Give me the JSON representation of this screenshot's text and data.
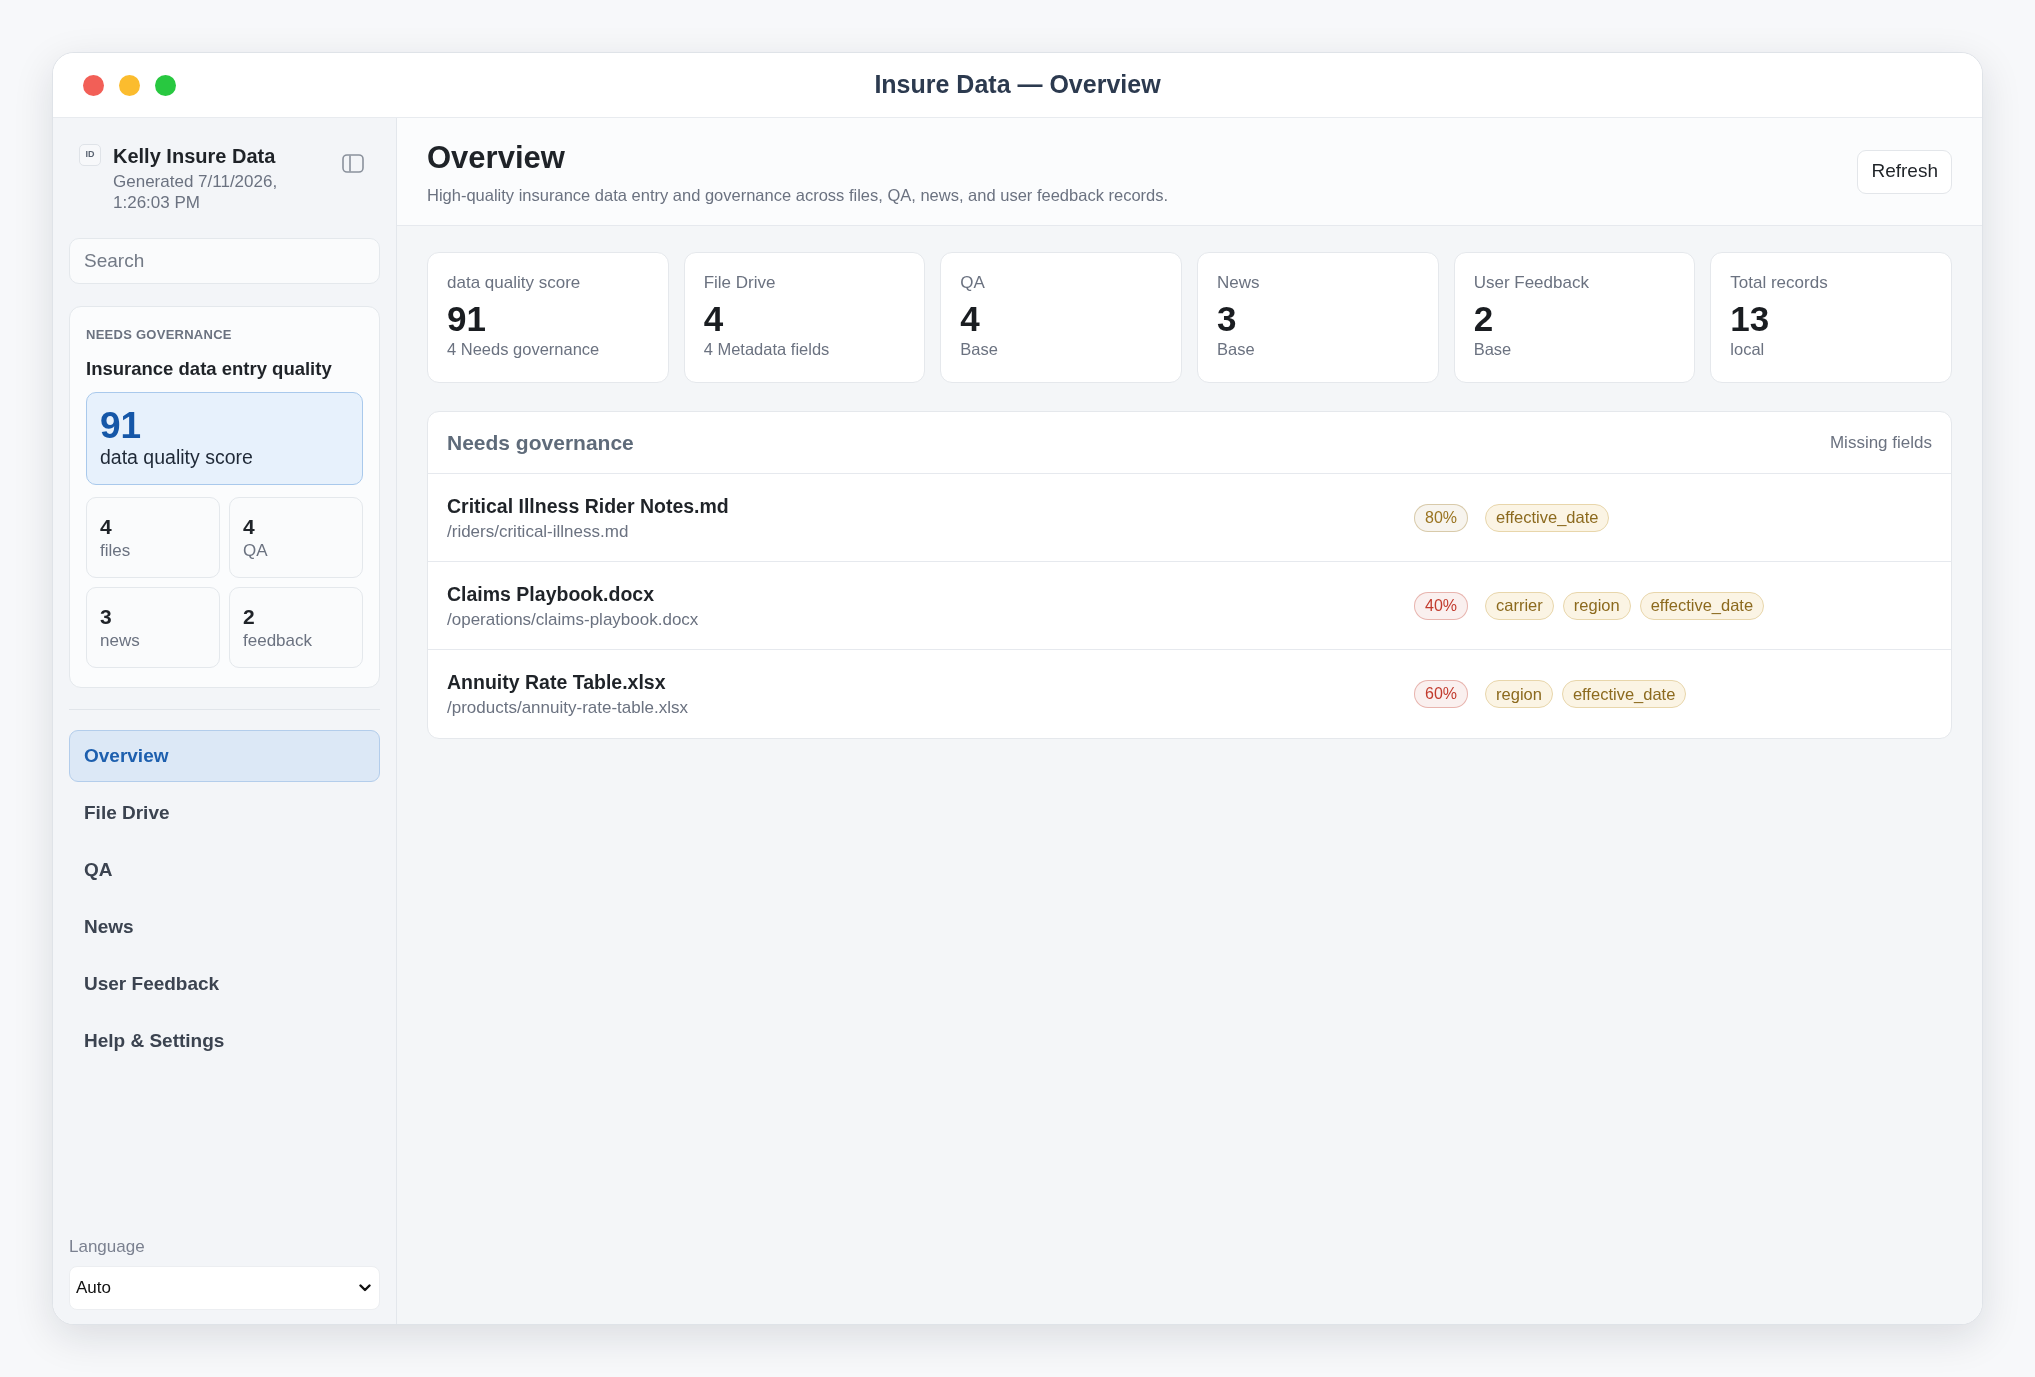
{
  "window": {
    "title": "Insure Data — Overview"
  },
  "sidebar": {
    "brand": {
      "badge": "ID",
      "name": "Kelly Insure Data",
      "generated": "Generated 7/11/2026, 1:26:03 PM"
    },
    "search": {
      "placeholder": "Search"
    },
    "summary_card": {
      "eyebrow": "NEEDS GOVERNANCE",
      "title": "Insurance data entry quality",
      "score": {
        "value": "91",
        "label": "data quality score"
      },
      "counts": [
        {
          "value": "4",
          "label": "files"
        },
        {
          "value": "4",
          "label": "QA"
        },
        {
          "value": "3",
          "label": "news"
        },
        {
          "value": "2",
          "label": "feedback"
        }
      ]
    },
    "nav": [
      {
        "label": "Overview",
        "selected": true
      },
      {
        "label": "File Drive",
        "selected": false
      },
      {
        "label": "QA",
        "selected": false
      },
      {
        "label": "News",
        "selected": false
      },
      {
        "label": "User Feedback",
        "selected": false
      },
      {
        "label": "Help & Settings",
        "selected": false
      }
    ],
    "language": {
      "label": "Language",
      "value": "Auto"
    }
  },
  "main": {
    "header": {
      "title": "Overview",
      "subtitle": "High-quality insurance data entry and governance across files, QA, news, and user feedback records.",
      "refresh_button": "Refresh"
    },
    "stats": [
      {
        "label": "data quality score",
        "value": "91",
        "note": "4 Needs governance"
      },
      {
        "label": "File Drive",
        "value": "4",
        "note": "4 Metadata fields"
      },
      {
        "label": "QA",
        "value": "4",
        "note": "Base"
      },
      {
        "label": "News",
        "value": "3",
        "note": "Base"
      },
      {
        "label": "User Feedback",
        "value": "2",
        "note": "Base"
      },
      {
        "label": "Total records",
        "value": "13",
        "note": "local"
      }
    ],
    "governance_table": {
      "title": "Needs governance",
      "column_label": "Missing fields",
      "rows": [
        {
          "name": "Critical Illness Rider Notes.md",
          "path": "/riders/critical-illness.md",
          "completeness": "80%",
          "color": "#9a7420",
          "missing_fields": [
            "effective_date"
          ]
        },
        {
          "name": "Claims Playbook.docx",
          "path": "/operations/claims-playbook.docx",
          "completeness": "40%",
          "color": "#c23b2e",
          "missing_fields": [
            "carrier",
            "region",
            "effective_date"
          ]
        },
        {
          "name": "Annuity Rate Table.xlsx",
          "path": "/products/annuity-rate-table.xlsx",
          "completeness": "60%",
          "color": "#c23b2e",
          "missing_fields": [
            "region",
            "effective_date"
          ]
        }
      ]
    }
  }
}
